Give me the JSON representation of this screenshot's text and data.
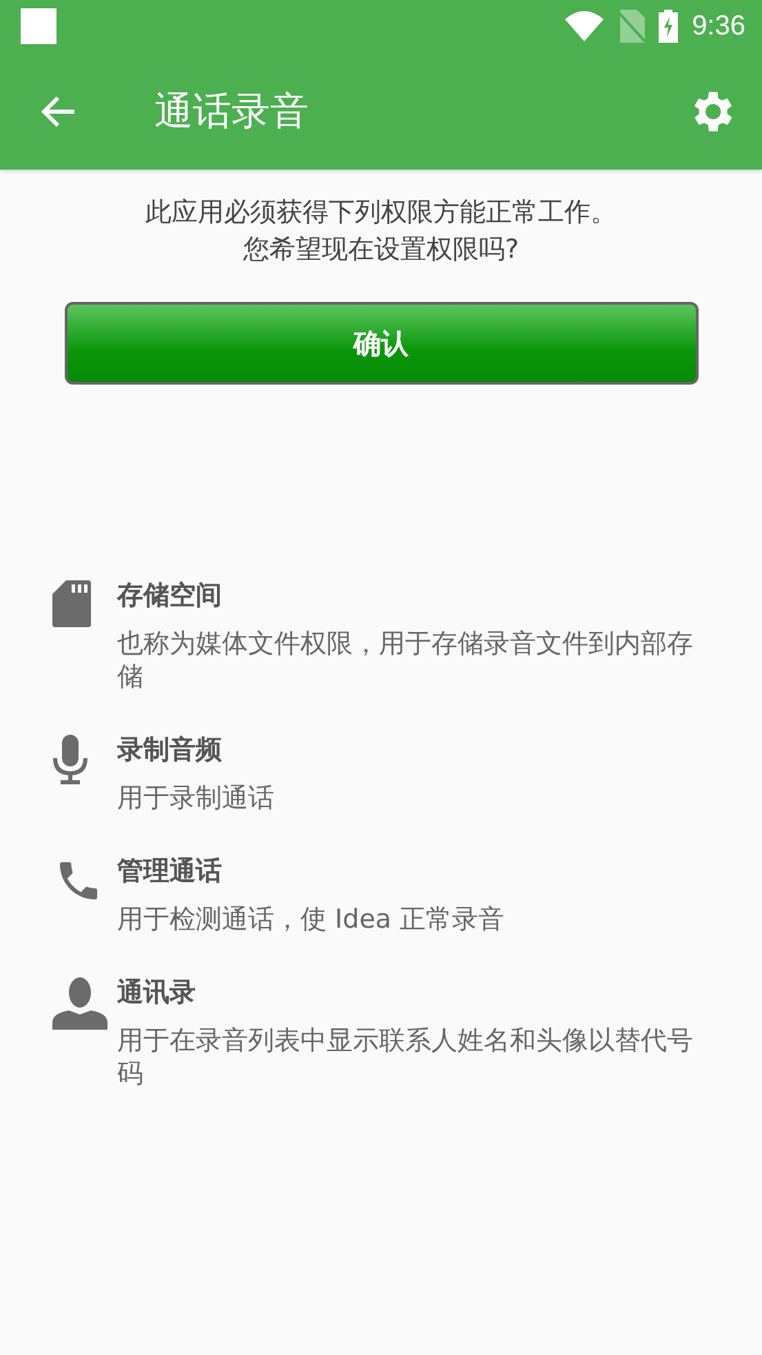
{
  "status_bar": {
    "time": "9:36"
  },
  "app_bar": {
    "title": "通话录音"
  },
  "intro": {
    "lines": [
      "此应用必须获得下列权限方能正常工作。",
      "您希望现在设置权限吗?"
    ]
  },
  "confirm_button": {
    "label": "确认"
  },
  "permissions": [
    {
      "kind": "storage",
      "title": "存储空间",
      "description": "也称为媒体文件权限，用于存储录音文件到内部存储"
    },
    {
      "kind": "microphone",
      "title": "录制音频",
      "description": "用于录制通话"
    },
    {
      "kind": "phone",
      "title": "管理通话",
      "description": "用于检测通话，使 Idea 正常录音"
    },
    {
      "kind": "contacts",
      "title": "通讯录",
      "description": "用于在录音列表中显示联系人姓名和头像以替代号码"
    }
  ]
}
